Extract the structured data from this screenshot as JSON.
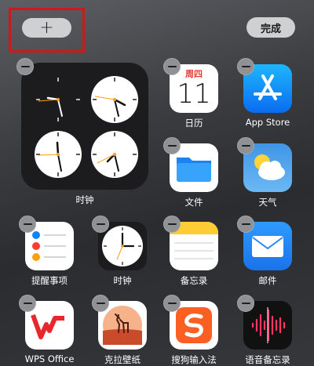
{
  "toolbar": {
    "add_label": "+",
    "done_label": "完成"
  },
  "widget": {
    "label": "时钟"
  },
  "apps": {
    "calendar": {
      "label": "日历",
      "weekday": "周四",
      "day": "11"
    },
    "appstore": {
      "label": "App Store",
      "icon": "appstore-icon"
    },
    "files": {
      "label": "文件",
      "icon": "folder-icon"
    },
    "weather": {
      "label": "天气",
      "icon": "cloud-sun-icon"
    },
    "reminders": {
      "label": "提醒事项",
      "icon": "reminders-icon"
    },
    "clock": {
      "label": "时钟",
      "icon": "clock-icon"
    },
    "notes": {
      "label": "备忘录",
      "icon": "notes-icon"
    },
    "mail": {
      "label": "邮件",
      "icon": "mail-icon"
    },
    "wps": {
      "label": "WPS Office",
      "icon": "wps-icon"
    },
    "kela": {
      "label": "克拉壁纸",
      "icon": "deer-icon"
    },
    "sogou": {
      "label": "搜狗输入法",
      "icon": "sogou-icon"
    },
    "voice": {
      "label": "语音备忘录",
      "icon": "waveform-icon"
    }
  },
  "colors": {
    "highlight": "#d01818",
    "calendar_red": "#e23b30"
  }
}
